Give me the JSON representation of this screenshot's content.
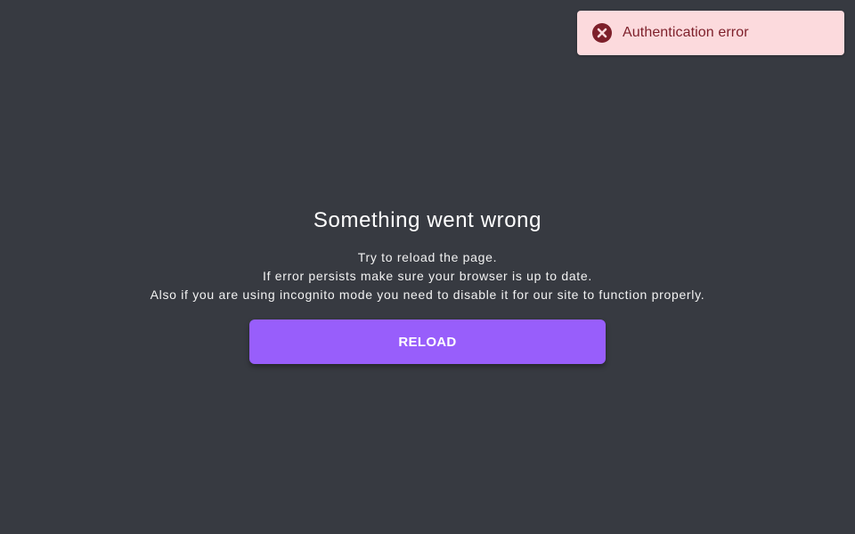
{
  "toast": {
    "icon": "error-circle-icon",
    "message": "Authentication error",
    "background": "#fcdadd",
    "text_color": "#7d1f2a",
    "icon_color": "#7d1f2a"
  },
  "main": {
    "title": "Something went wrong",
    "messages": [
      "Try to reload the page.",
      "If error persists make sure your browser is up to date.",
      "Also if you are using incognito mode you need to disable it for our site to function properly."
    ],
    "reload_label": "RELOAD",
    "accent_color": "#985efb",
    "background_color": "#373a41"
  }
}
